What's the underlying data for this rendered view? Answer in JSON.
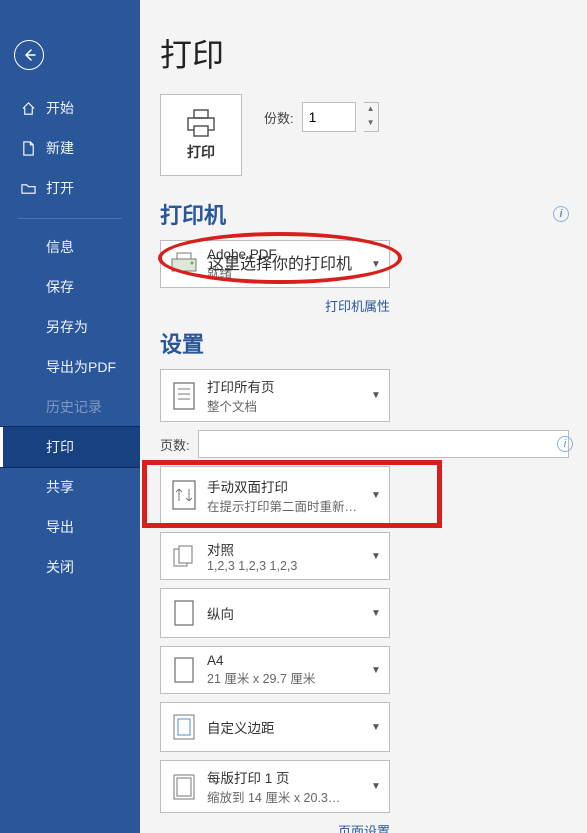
{
  "sidebar": {
    "items": [
      {
        "label": "开始"
      },
      {
        "label": "新建"
      },
      {
        "label": "打开"
      },
      {
        "label": "信息"
      },
      {
        "label": "保存"
      },
      {
        "label": "另存为"
      },
      {
        "label": "导出为PDF"
      },
      {
        "label": "历史记录"
      },
      {
        "label": "打印"
      },
      {
        "label": "共享"
      },
      {
        "label": "导出"
      },
      {
        "label": "关闭"
      }
    ]
  },
  "main": {
    "title": "打印",
    "print_btn": "打印",
    "copies_label": "份数:",
    "copies_value": "1",
    "printer_heading": "打印机",
    "printer": {
      "name": "Adobe PDF",
      "status": "就绪",
      "overlay": "这里选择你的打印机"
    },
    "printer_props": "打印机属性",
    "settings_heading": "设置",
    "dd_pages": {
      "title": "打印所有页",
      "sub": "整个文档"
    },
    "pages_label": "页数:",
    "dd_duplex": {
      "title": "手动双面打印",
      "sub": "在提示打印第二面时重新…"
    },
    "dd_collate": {
      "title": "对照",
      "sub": "1,2,3    1,2,3    1,2,3"
    },
    "dd_orient": {
      "title": "纵向"
    },
    "dd_paper": {
      "title": "A4",
      "sub": "21 厘米 x 29.7 厘米"
    },
    "dd_margins": {
      "title": "自定义边距"
    },
    "dd_ppsheet": {
      "title": "每版打印 1 页",
      "sub": "缩放到 14 厘米 x 20.3…"
    },
    "page_setup": "页面设置"
  }
}
